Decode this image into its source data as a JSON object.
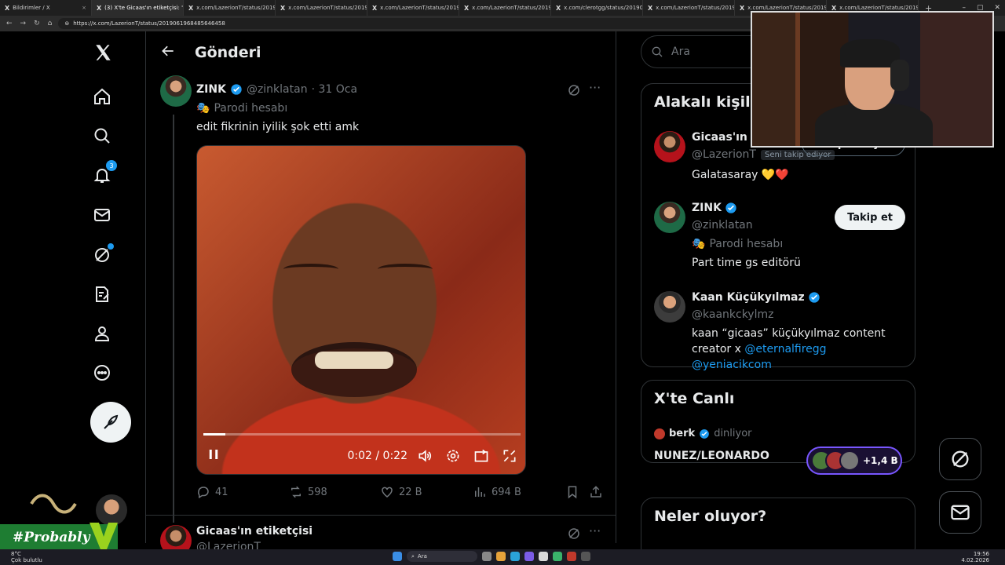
{
  "browser": {
    "tabs": [
      {
        "label": "Bildirimler / X",
        "active": false
      },
      {
        "label": "(3) X'te Gicaas'ın etiketçisi: \"",
        "active": true
      },
      {
        "label": "x.com/LazerionT/status/20190628",
        "active": false
      },
      {
        "label": "x.com/LazerionT/status/20190628",
        "active": false
      },
      {
        "label": "x.com/LazerionT/status/20190628",
        "active": false
      },
      {
        "label": "x.com/LazerionT/status/20190628",
        "active": false
      },
      {
        "label": "x.com/clerotgg/status/20190656",
        "active": false
      },
      {
        "label": "x.com/LazerionT/status/20190628",
        "active": false
      },
      {
        "label": "x.com/LazerionT/status/20190628",
        "active": false
      },
      {
        "label": "x.com/LazerionT/status/20190628",
        "active": false
      }
    ],
    "url": "https://x.com/LazerionT/status/2019061968485646458"
  },
  "nav": {
    "notification_count": "3"
  },
  "header": {
    "title": "Gönderi"
  },
  "tweet": {
    "name": "ZINK",
    "handle": "@zinklatan",
    "date": "· 31 Oca",
    "parody_label": "Parodi hesabı",
    "text": "edit fikrinin iyilik şok etti amk",
    "video": {
      "time": "0:02 / 0:22",
      "progress": 0.07
    },
    "stats": {
      "replies": "41",
      "reposts": "598",
      "likes": "22 B",
      "views": "694 B"
    }
  },
  "reply": {
    "name": "Gicaas'ın etiketçisi",
    "handle": "@LazerionT"
  },
  "sidebar": {
    "search_placeholder": "Ara",
    "related": {
      "title": "Alakalı kişiler",
      "people": [
        {
          "name": "Gicaas'ın etiketçisi",
          "handle": "@LazerionT",
          "follows_you": "Seni takip ediyor",
          "button": "Takip ediliyor",
          "bio": "Galatasaray 💛❤️"
        },
        {
          "name": "ZINK",
          "handle": "@zinklatan",
          "parody": "Parodi hesabı",
          "button": "Takip et",
          "bio": "Part time gs editörü"
        },
        {
          "name": "Kaan Küçükyılmaz",
          "handle": "@kaankckylmz",
          "bio_line1": "kaan “gicaas” küçükyılmaz content",
          "bio_line2_prefix": "creator x ",
          "bio_link1": "@eternalfiregg",
          "bio_link2": "@yeniacikcom"
        }
      ]
    },
    "live": {
      "title": "X'te Canlı",
      "host": "berk",
      "status": "dinliyor",
      "space_title": "NUNEZ/LEONARDO",
      "listeners": "+1,4 B"
    },
    "trends": {
      "title": "Neler oluyor?"
    }
  },
  "overlay": {
    "brand": "#Probably"
  },
  "taskbar": {
    "temp": "8°C",
    "weather": "Çok bulutlu",
    "search": "Ara",
    "time": "19:56",
    "date": "4.02.2026"
  },
  "colors": {
    "accent": "#1d9bf0",
    "background": "#000000",
    "border": "#2f3336",
    "muted": "#71767b"
  }
}
